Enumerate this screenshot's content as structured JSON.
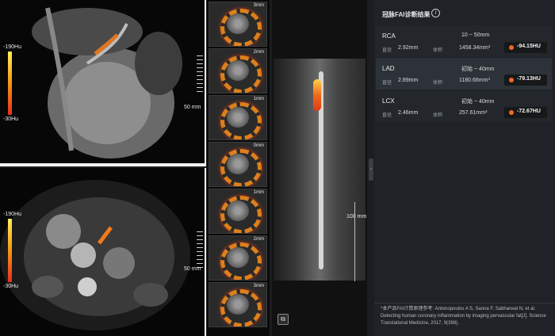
{
  "panel": {
    "title": "冠脉FAI诊断结果",
    "info_icon": "i",
    "vessels": [
      {
        "name": "RCA",
        "range": "10 ~ 50mm",
        "diam_label": "直径",
        "diam": "2.92mm",
        "vol_label": "体积",
        "vol": "1458.34mm³",
        "hu": "-94.15HU"
      },
      {
        "name": "LAD",
        "range": "初始 ~ 40mm",
        "diam_label": "直径",
        "diam": "2.89mm",
        "vol_label": "体积",
        "vol": "1180.66mm³",
        "hu": "-79.13HU"
      },
      {
        "name": "LCX",
        "range": "初始 ~ 40mm",
        "diam_label": "直径",
        "diam": "2.46mm",
        "vol_label": "体积",
        "vol": "257.61mm³",
        "hu": "-72.67HU"
      }
    ],
    "reference": "*本产品FAI计算原理参考: Antonopoulos A S, Sanna F, Sabharwal N, et al. Detecting human coronary inflammation by imaging pervascular fat[J]. Science Translational Medicine, 2017, 9(398)."
  },
  "colorscale": {
    "top": "-190Hu",
    "bottom": "-30Hu"
  },
  "viewports": {
    "top_ruler": "50 mm",
    "bottom_ruler": "50 mm"
  },
  "cpr": {
    "ruler": "100 mm",
    "button_icon": "screenshot-icon"
  },
  "strip_labels": [
    "3mm",
    "2mm",
    "1mm",
    "0mm",
    "1mm",
    "2mm",
    "3mm"
  ],
  "colors": {
    "accent": "#f06a22",
    "panel_bg": "#1f2226",
    "active_card": "#2c3238"
  }
}
